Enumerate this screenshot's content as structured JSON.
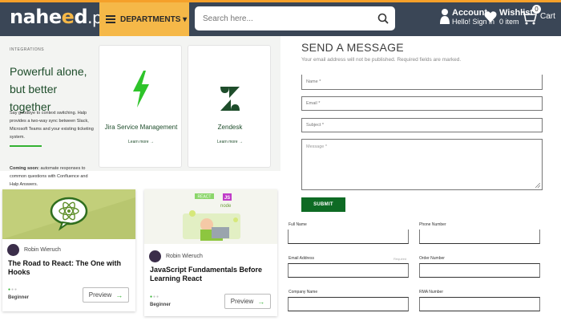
{
  "header": {
    "logo_main": "nahe",
    "logo_mid": "e",
    "logo_tail": "d",
    "logo_domain": ".pk",
    "departments_label": "DEPARTMENTS ▾",
    "search_placeholder": "Search here...",
    "account_title": "Account",
    "account_sub": "Hello! Sign in",
    "wishlist_title": "Wishlist",
    "wishlist_sub": "0 item",
    "cart_label": "Cart",
    "cart_count": "0",
    "colors": {
      "bar": "#3a4656",
      "accent": "#f5b848",
      "top_line": "#f5a02a"
    }
  },
  "promo": {
    "eyebrow": "INTEGRATIONS",
    "heading": "Powerful alone, but better together",
    "description": "Say goodbye to context switching. Halp provides a two-way sync between Slack, Microsoft Teams and your existing ticketing system.",
    "coming_bold": "Coming soon:",
    "coming_text": " automate responses to common questions with Confluence and Halp Answers.",
    "cards": [
      {
        "label": "Jira Service Management",
        "link": "Learn more →",
        "icon": "jira-bolt-icon"
      },
      {
        "label": "Zendesk",
        "link": "Learn more →",
        "icon": "zendesk-icon"
      }
    ]
  },
  "courses": [
    {
      "author": "Robin Wieruch",
      "title": "The Road to React: The One with Hooks",
      "level": "Beginner",
      "preview": "Preview",
      "arrow": "→",
      "dots_on": "●",
      "dots_off": "●●"
    },
    {
      "author": "Robin Wieruch",
      "title": "JavaScript Fundamentals Before Learning React",
      "level": "Beginner",
      "preview": "Preview",
      "arrow": "→",
      "dots_on": "●",
      "dots_off": "●●",
      "badges": {
        "react": "REACT",
        "js": "JS",
        "node": "node"
      }
    }
  ],
  "message_form": {
    "title": "SEND A MESSAGE",
    "note": "Your email address will not be published. Required fields are marked.",
    "name_placeholder": "Name *",
    "email_placeholder": "Email *",
    "subject_placeholder": "Subject *",
    "message_placeholder": "Message *",
    "submit_label": "SUBMIT"
  },
  "lower_form": {
    "full_name": "Full Name",
    "phone": "Phone Number",
    "email": "Email Address",
    "required": "Required",
    "order": "Order Number",
    "company": "Company Name",
    "rma": "RMA Number"
  }
}
